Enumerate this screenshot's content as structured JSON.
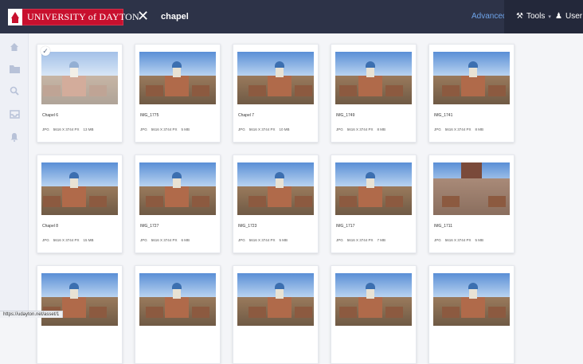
{
  "header": {
    "brand": "UNIVERSITY of DAYTON",
    "search_query": "chapel",
    "advanced_label": "Advanced",
    "tools_label": "Tools",
    "user_label": "User",
    "brand_color": "#c8102e",
    "bar_color": "#2d3348"
  },
  "sidebar": {
    "icons": [
      "home-icon",
      "folder-icon",
      "search-icon",
      "inbox-icon",
      "bell-icon"
    ]
  },
  "assets": [
    {
      "title": "Chapel 6",
      "format": "JPG",
      "dimensions": "5616 X 3744 PX",
      "size": "13 MB",
      "selected": true
    },
    {
      "title": "IMG_1775",
      "format": "JPG",
      "dimensions": "5616 X 3744 PX",
      "size": "5 MB",
      "selected": false
    },
    {
      "title": "Chapel 7",
      "format": "JPG",
      "dimensions": "5616 X 3744 PX",
      "size": "10 MB",
      "selected": false
    },
    {
      "title": "IMG_1749",
      "format": "JPG",
      "dimensions": "5616 X 3744 PX",
      "size": "8 MB",
      "selected": false
    },
    {
      "title": "IMG_1741",
      "format": "JPG",
      "dimensions": "5616 X 3744 PX",
      "size": "8 MB",
      "selected": false
    },
    {
      "title": "Chapel 8",
      "format": "JPG",
      "dimensions": "5616 X 3744 PX",
      "size": "15 MB",
      "selected": false
    },
    {
      "title": "IMG_1727",
      "format": "JPG",
      "dimensions": "5616 X 3744 PX",
      "size": "6 MB",
      "selected": false
    },
    {
      "title": "IMG_1723",
      "format": "JPG",
      "dimensions": "5616 X 3744 PX",
      "size": "5 MB",
      "selected": false
    },
    {
      "title": "IMG_1717",
      "format": "JPG",
      "dimensions": "5616 X 3744 PX",
      "size": "7 MB",
      "selected": false
    },
    {
      "title": "IMG_1711",
      "format": "JPG",
      "dimensions": "5616 X 3744 PX",
      "size": "5 MB",
      "selected": false
    },
    {
      "title": "",
      "format": "",
      "dimensions": "",
      "size": "",
      "selected": false
    },
    {
      "title": "",
      "format": "",
      "dimensions": "",
      "size": "",
      "selected": false
    },
    {
      "title": "",
      "format": "",
      "dimensions": "",
      "size": "",
      "selected": false
    },
    {
      "title": "",
      "format": "",
      "dimensions": "",
      "size": "",
      "selected": false
    },
    {
      "title": "",
      "format": "",
      "dimensions": "",
      "size": "",
      "selected": false
    }
  ],
  "status_bar": {
    "url": "https://udayton.net/asset/1"
  }
}
